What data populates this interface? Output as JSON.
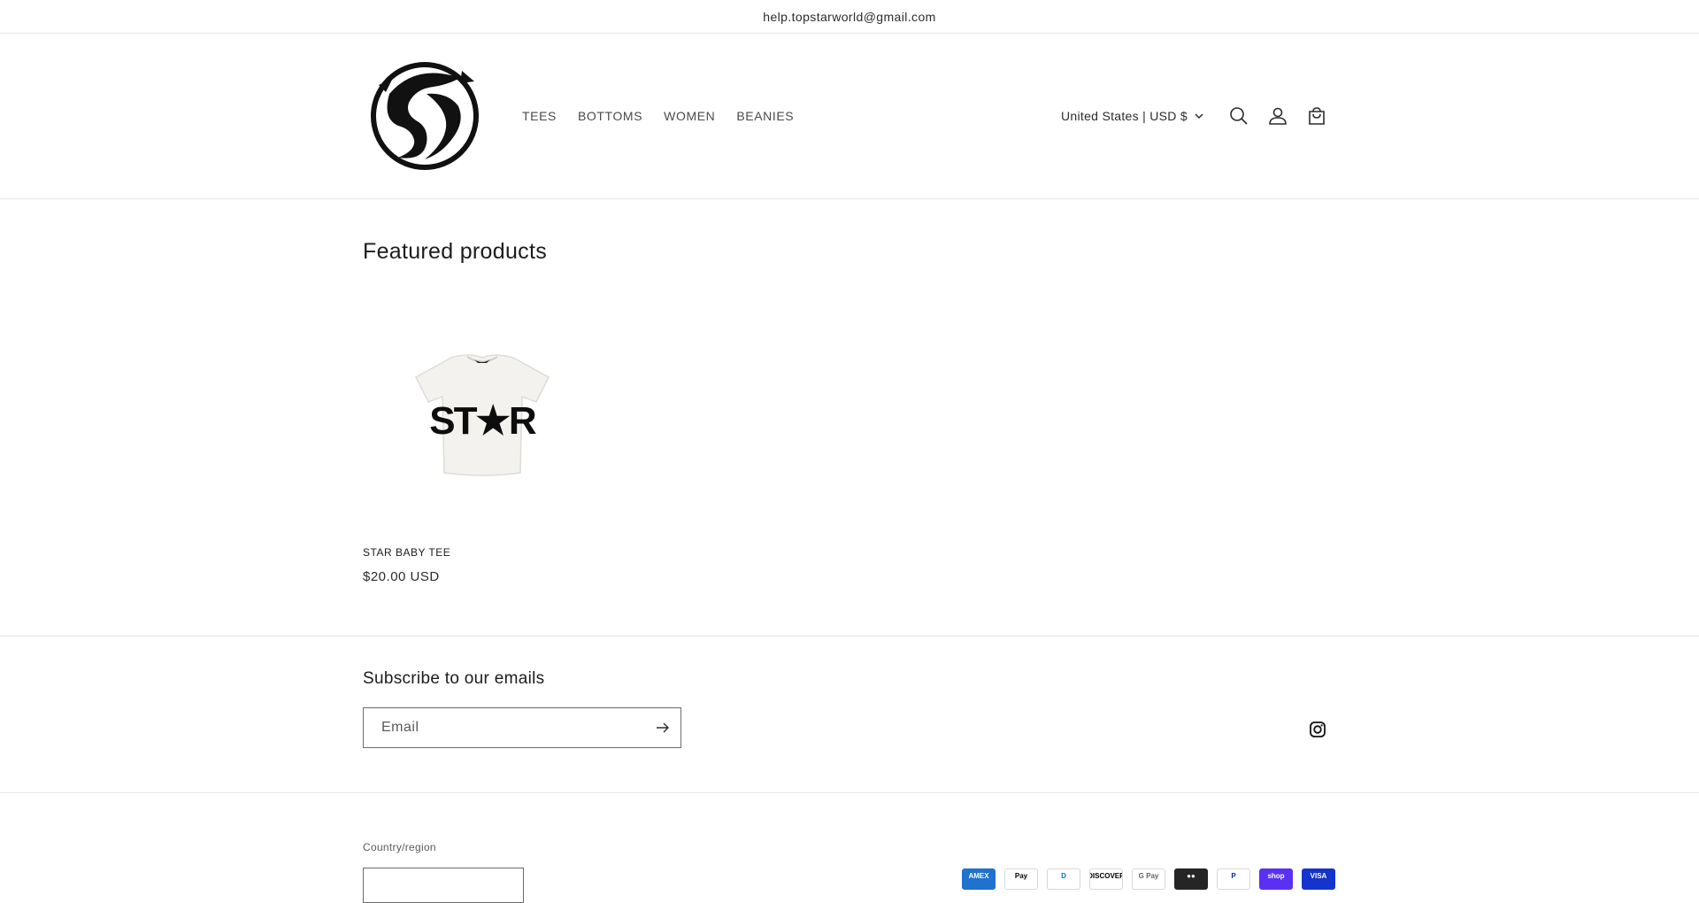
{
  "announcement": {
    "text": "help.topstarworld@gmail.com"
  },
  "header": {
    "nav": [
      {
        "label": "TEES"
      },
      {
        "label": "BOTTOMS"
      },
      {
        "label": "WOMEN"
      },
      {
        "label": "BEANIES"
      }
    ],
    "country_currency": "United States | USD $"
  },
  "featured": {
    "heading": "Featured products",
    "products": [
      {
        "title": "STAR BABY TEE",
        "price": "$20.00 USD",
        "shirt_print": "ST★R"
      }
    ]
  },
  "subscribe": {
    "heading": "Subscribe to our emails",
    "email_placeholder": "Email"
  },
  "footer": {
    "country_label": "Country/region",
    "payment_methods": [
      {
        "name": "amex-icon",
        "label": "AMEX"
      },
      {
        "name": "apple-pay-icon",
        "label": "Pay"
      },
      {
        "name": "diners-icon",
        "label": "D"
      },
      {
        "name": "discover-icon",
        "label": "DISCOVER"
      },
      {
        "name": "google-pay-icon",
        "label": "G Pay"
      },
      {
        "name": "mastercard-icon",
        "label": "●●"
      },
      {
        "name": "paypal-icon",
        "label": "P"
      },
      {
        "name": "shop-pay-icon",
        "label": "shop"
      },
      {
        "name": "visa-icon",
        "label": "VISA"
      }
    ]
  }
}
